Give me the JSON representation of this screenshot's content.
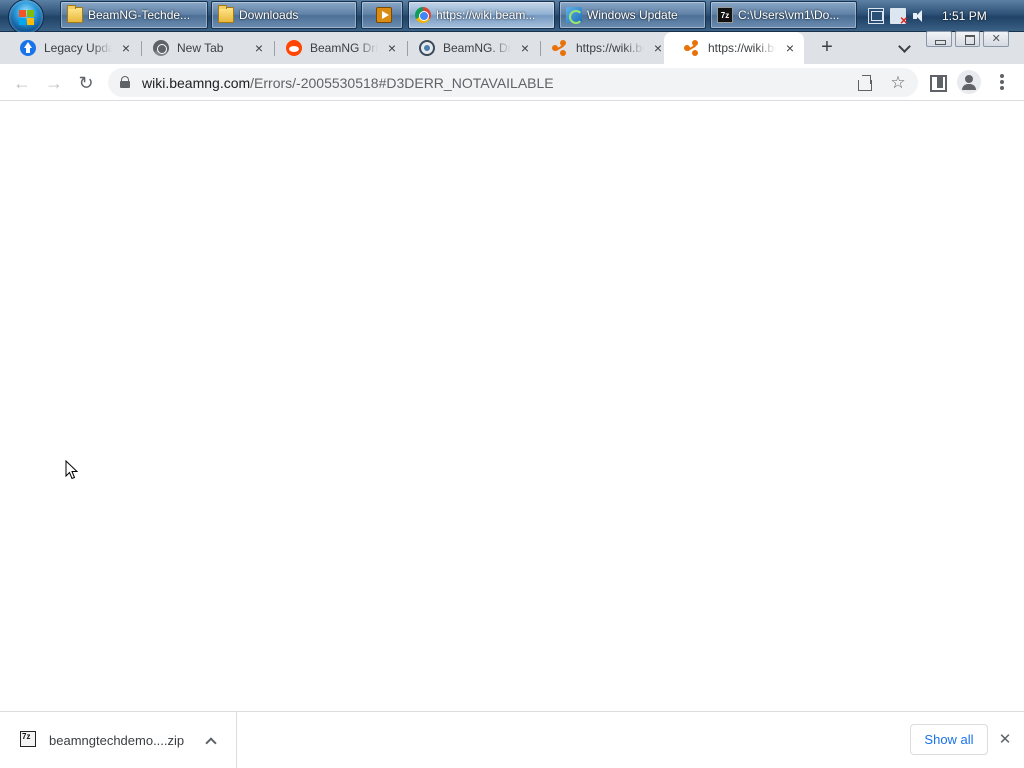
{
  "taskbar": {
    "buttons": [
      {
        "label": "BeamNG-Techde...",
        "icon": "folder-icon",
        "active": false
      },
      {
        "label": "Downloads",
        "icon": "downloads-folder-icon",
        "active": false
      },
      {
        "label": "",
        "icon": "media-player-icon",
        "active": false
      },
      {
        "label": "https://wiki.beam...",
        "icon": "chrome-icon",
        "active": true
      },
      {
        "label": "Windows Update",
        "icon": "windows-update-icon",
        "active": false
      },
      {
        "label": "C:\\Users\\vm1\\Do...",
        "icon": "7zip-icon",
        "active": false
      }
    ],
    "tray_icons": [
      "network-icon",
      "action-center-flag-icon",
      "volume-icon"
    ],
    "clock": "1:51 PM"
  },
  "browser": {
    "tabs": [
      {
        "title": "Legacy Update",
        "favicon": "legacy-update-favicon",
        "active": false
      },
      {
        "title": "New Tab",
        "favicon": "chrome-newtab-favicon",
        "active": false
      },
      {
        "title": "BeamNG Drive",
        "favicon": "reddit-favicon",
        "active": false
      },
      {
        "title": "BeamNG. Drive",
        "favicon": "beamng-favicon",
        "active": false
      },
      {
        "title": "https://wiki.beamng.com",
        "favicon": "wiki-favicon",
        "active": false
      },
      {
        "title": "https://wiki.beamng.com",
        "favicon": "wiki-favicon",
        "active": true
      }
    ],
    "new_tab_symbol": "+",
    "tab_close_symbol": "×",
    "address": {
      "host": "wiki.beamng.com",
      "path": "/Errors/-2005530518#D3DERR_NOTAVAILABLE"
    },
    "nav": {
      "back": "←",
      "forward": "→",
      "reload": "↻"
    },
    "star_symbol": "☆"
  },
  "download_shelf": {
    "items": [
      {
        "filename": "beamngtechdemo....zip",
        "icon": "7zip-archive-icon"
      }
    ],
    "show_all_label": "Show all",
    "close_symbol": "✕"
  },
  "colors": {
    "accent": "#1a73e8",
    "tab_strip": "#dee1e6",
    "omnibox": "#f1f3f4",
    "wiki_favicon": "#e8710a"
  }
}
